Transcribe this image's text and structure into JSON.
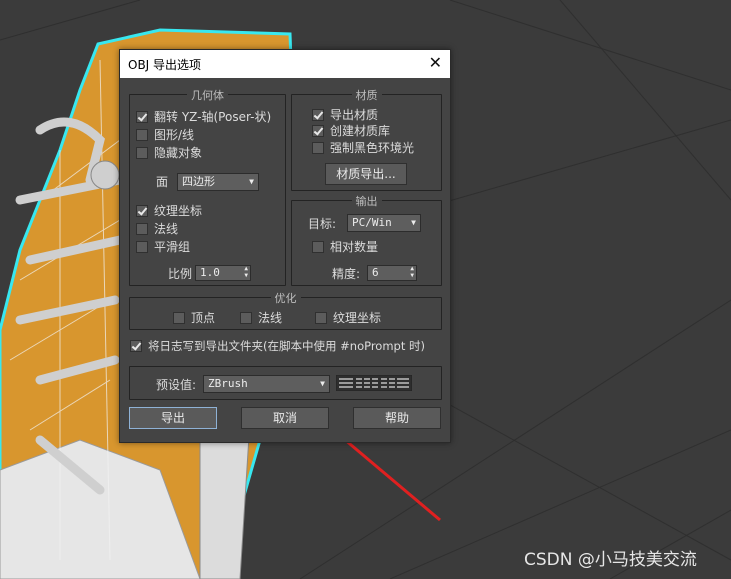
{
  "dialog": {
    "title": "OBJ 导出选项",
    "close_glyph": "✕",
    "geometry": {
      "title": "几何体",
      "flip_yz": {
        "label": "翻转 YZ-轴(Poser-状)",
        "checked": true
      },
      "shapes": {
        "label": "图形/线",
        "checked": false
      },
      "hidden": {
        "label": "隐藏对象",
        "checked": false
      },
      "faces_label": "面",
      "faces_value": "四边形",
      "texture_coords": {
        "label": "纹理坐标",
        "checked": true
      },
      "normals": {
        "label": "法线",
        "checked": false
      },
      "smoothing": {
        "label": "平滑组",
        "checked": false
      },
      "scale_label": "比例",
      "scale_value": "1.0"
    },
    "material": {
      "title": "材质",
      "export_materials": {
        "label": "导出材质",
        "checked": true
      },
      "create_library": {
        "label": "创建材质库",
        "checked": true
      },
      "force_black": {
        "label": "强制黑色环境光",
        "checked": false
      },
      "export_button": "材质导出..."
    },
    "output": {
      "title": "输出",
      "target_label": "目标:",
      "target_value": "PC/Win",
      "relative_numbers": {
        "label": "相对数量",
        "checked": false
      },
      "precision_label": "精度:",
      "precision_value": "6"
    },
    "optimize": {
      "title": "优化",
      "vertices": {
        "label": "顶点",
        "checked": false
      },
      "normals": {
        "label": "法线",
        "checked": false
      },
      "texture_coords": {
        "label": "纹理坐标",
        "checked": false
      }
    },
    "log": {
      "label": "将日志写到导出文件夹(在脚本中使用 #noPrompt 时)",
      "checked": true
    },
    "preset": {
      "label": "预设值:",
      "value": "ZBrush",
      "grid_icon": "preset-grid-icon"
    },
    "buttons": {
      "export": "导出",
      "cancel": "取消",
      "help": "帮助"
    }
  },
  "annotation": {
    "arrow_color": "#e02020"
  },
  "watermark": "CSDN @小马技美交流",
  "colors": {
    "viewport_bg": "#3a3a3a",
    "shoe_orange": "#d8962e",
    "selection_cyan": "#38e8f0",
    "dialog_bg": "#444444"
  }
}
